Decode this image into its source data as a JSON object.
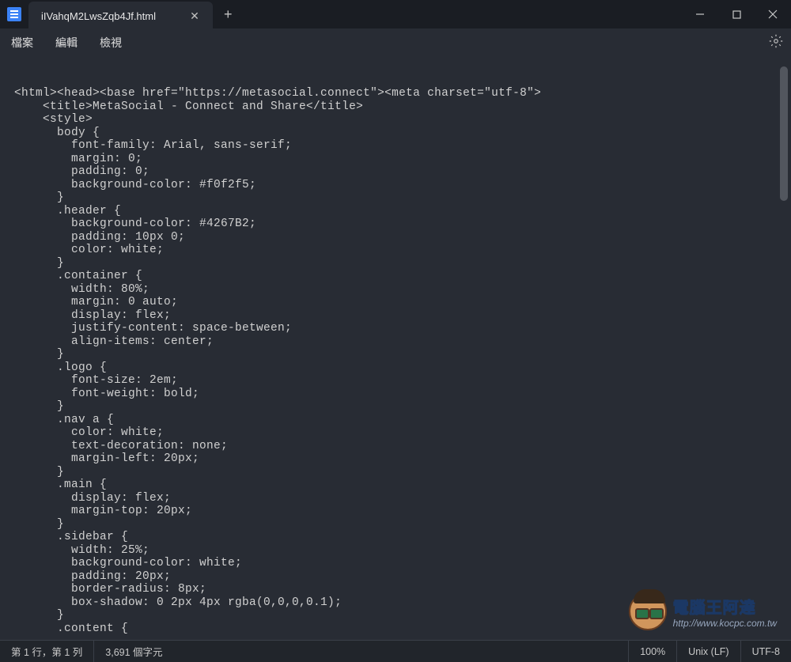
{
  "tab": {
    "title": "iIVahqM2LwsZqb4Jf.html"
  },
  "menu": {
    "file": "檔案",
    "edit": "編輯",
    "view": "檢視"
  },
  "code": "<html><head><base href=\"https://metasocial.connect\"><meta charset=\"utf-8\">\n    <title>MetaSocial - Connect and Share</title>\n    <style>\n      body {\n        font-family: Arial, sans-serif;\n        margin: 0;\n        padding: 0;\n        background-color: #f0f2f5;\n      }\n      .header {\n        background-color: #4267B2;\n        padding: 10px 0;\n        color: white;\n      }\n      .container {\n        width: 80%;\n        margin: 0 auto;\n        display: flex;\n        justify-content: space-between;\n        align-items: center;\n      }\n      .logo {\n        font-size: 2em;\n        font-weight: bold;\n      }\n      .nav a {\n        color: white;\n        text-decoration: none;\n        margin-left: 20px;\n      }\n      .main {\n        display: flex;\n        margin-top: 20px;\n      }\n      .sidebar {\n        width: 25%;\n        background-color: white;\n        padding: 20px;\n        border-radius: 8px;\n        box-shadow: 0 2px 4px rgba(0,0,0,0.1);\n      }\n      .content {",
  "status": {
    "cursor": "第 1 行，第 1 列",
    "chars": "3,691 個字元",
    "zoom": "100%",
    "eol": "Unix (LF)",
    "encoding": "UTF-8"
  },
  "watermark": {
    "line1": "電腦王阿達",
    "line2": "http://www.kocpc.com.tw"
  }
}
